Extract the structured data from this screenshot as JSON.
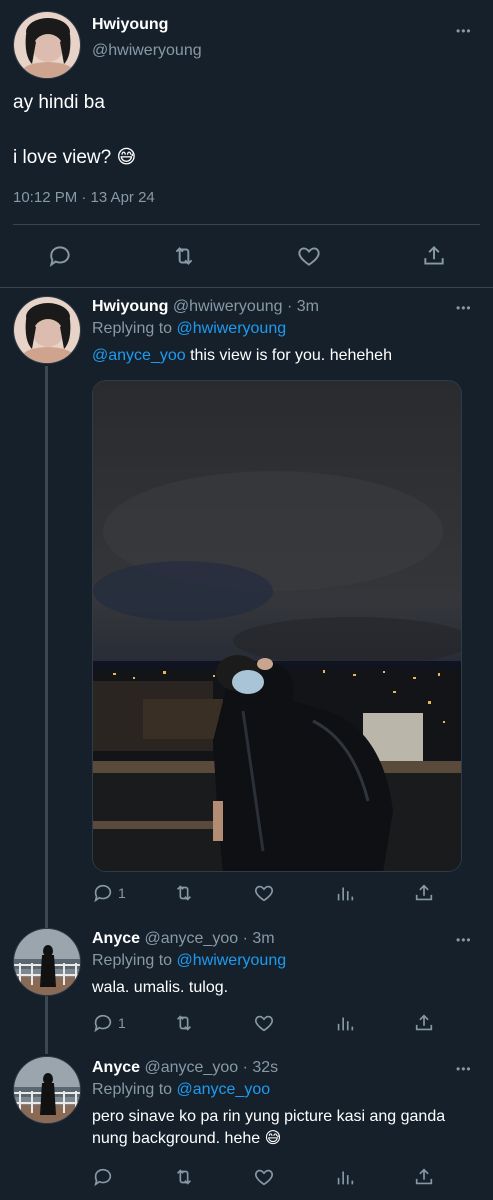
{
  "main_tweet": {
    "author_name": "Hwiyoung",
    "author_handle": "@hwiweryoung",
    "line1": "ay hindi ba",
    "line2": "i love view? 😅",
    "timestamp": "10:12 PM · 13 Apr 24",
    "more_label": "•••"
  },
  "replies": [
    {
      "author_name": "Hwiyoung",
      "meta": "@hwiweryoung · 3m",
      "replying_prefix": "Replying to",
      "replying_to": "@hwiweryoung",
      "mention": "@anyce_yoo",
      "text": " this view is for you. heheheh",
      "reply_count": "1",
      "more_label": "•••"
    },
    {
      "author_name": "Anyce",
      "meta": "@anyce_yoo · 3m",
      "replying_prefix": "Replying to",
      "replying_to": "@hwiweryoung",
      "text": "wala. umalis. tulog.",
      "reply_count": "1",
      "more_label": "•••"
    },
    {
      "author_name": "Anyce",
      "meta": "@anyce_yoo · 32s",
      "replying_prefix": "Replying to",
      "replying_to": "@anyce_yoo",
      "text_line1": "pero sinave ko pa rin yung picture kasi ang ganda",
      "text_line2": "nung background. hehe 😅",
      "more_label": "•••"
    }
  ],
  "icons": [
    "reply-icon",
    "retweet-icon",
    "like-icon",
    "share-icon",
    "analytics-icon",
    "more-icon"
  ],
  "colors": {
    "background": "#15202b",
    "accent": "#1d9bf0",
    "muted": "#8899a6"
  }
}
